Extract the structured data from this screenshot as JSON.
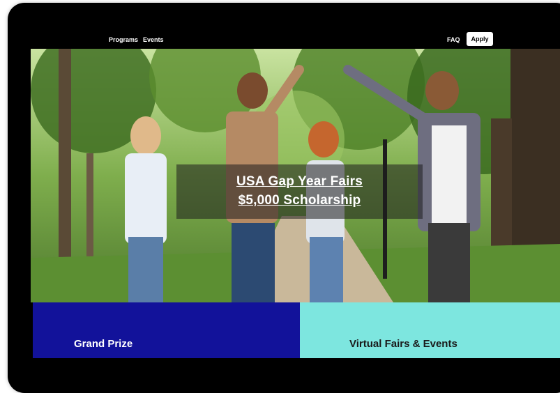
{
  "nav": {
    "items": [
      {
        "label": "Programs"
      },
      {
        "label": "Events"
      }
    ],
    "faq_label": "FAQ",
    "apply_label": "Apply"
  },
  "hero": {
    "title_line1": "USA Gap Year Fairs",
    "title_line2": "$5,000 Scholarship",
    "image_subject": "four students giving high-fives on a tree-lined path"
  },
  "panels": [
    {
      "label": "Grand Prize",
      "color": "#12129a"
    },
    {
      "label": "Virtual Fairs & Events",
      "color": "#7de6df"
    }
  ],
  "colors": {
    "frame": "#000000",
    "apply_bg": "#ffffff"
  }
}
